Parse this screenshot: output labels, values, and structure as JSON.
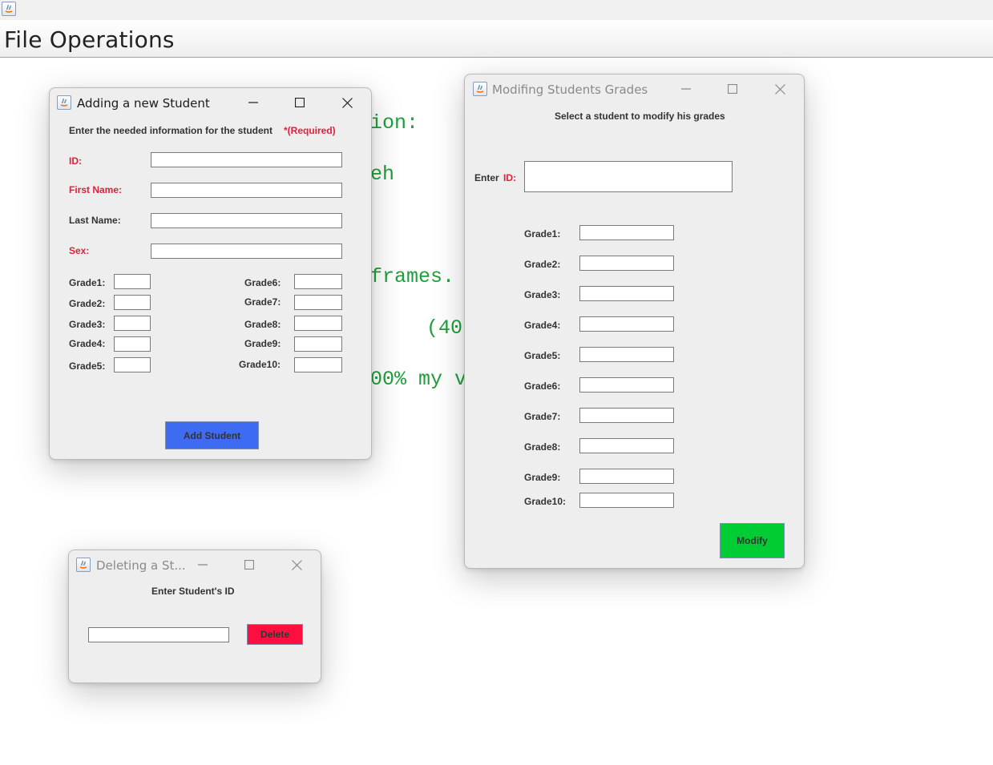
{
  "app": {
    "menu": {
      "file_operations": "File Operations"
    }
  },
  "background_fragments": [
    {
      "text": "ion:"
    },
    {
      "text": "eh"
    },
    {
      "text": "frames."
    },
    {
      "text": "(40"
    },
    {
      "text": "00% my v"
    }
  ],
  "add_window": {
    "title": "Adding a new Student",
    "instruction": "Enter the needed information for the student",
    "required_note": "*(Required)",
    "labels": {
      "id": "ID:",
      "first_name": "First Name:",
      "last_name": "Last Name:",
      "sex": "Sex:"
    },
    "values": {
      "id": "",
      "first_name": "",
      "last_name": "",
      "sex": ""
    },
    "grades_left": [
      "Grade1:",
      "Grade2:",
      "Grade3:",
      "Grade4:",
      "Grade5:"
    ],
    "grades_right": [
      "Grade6:",
      "Grade7:",
      "Grade8:",
      "Grade9:",
      "Grade10:"
    ],
    "button": "Add Student",
    "colors": {
      "button": "#3d6bf2",
      "required": "#e0203c"
    }
  },
  "modify_window": {
    "title": "Modifing Students Grades",
    "instruction": "Select a student to modify his grades",
    "enter_label": "Enter",
    "id_label": "ID:",
    "id_value": "",
    "grades": [
      "Grade1:",
      "Grade2:",
      "Grade3:",
      "Grade4:",
      "Grade5:",
      "Grade6:",
      "Grade7:",
      "Grade8:",
      "Grade9:",
      "Grade10:"
    ],
    "button": "Modify",
    "colors": {
      "button": "#00cc33"
    }
  },
  "delete_window": {
    "title": "Deleting a St...",
    "instruction": "Enter Student's ID",
    "id_value": "",
    "button": "Delete",
    "colors": {
      "button": "#ff0f3f"
    }
  },
  "icons": [
    "java-icon",
    "minimize-icon",
    "maximize-icon",
    "close-icon"
  ]
}
